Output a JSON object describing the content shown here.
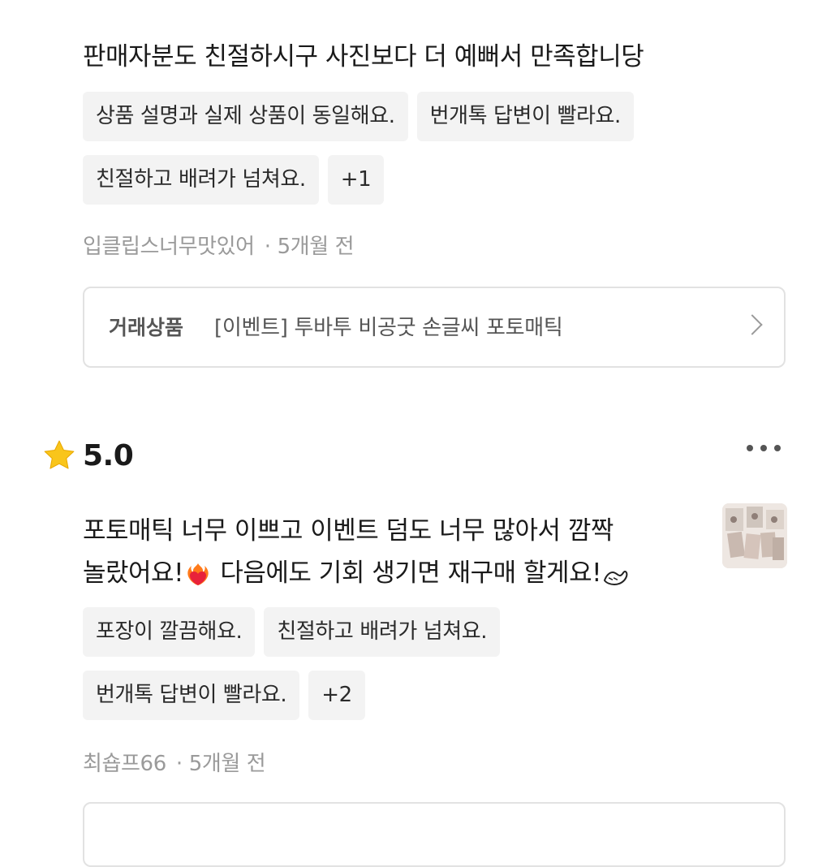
{
  "review1": {
    "text": "판매자분도 친절하시구 사진보다 더 예뻐서 만족합니당",
    "tags_row1": [
      "상품 설명과 실제 상품이 동일해요.",
      "번개톡 답변이 빨라요."
    ],
    "tags_row2": [
      "친절하고 배려가 넘쳐요.",
      "+1"
    ],
    "author": "입클립스너무맛있어",
    "time": "5개월 전",
    "product_label": "거래상품",
    "product_name": "[이벤트] 투바투 비공굿 손글씨 포토매틱"
  },
  "review2": {
    "rating": "5.0",
    "text_line1": "포토매틱 너무 이쁘고 이벤트 덤도 너무 많아서 깜짝",
    "text_line2a": "놀랐어요!",
    "text_line2b": " 다음에도 기회 생기면 재구매 할게요!",
    "tags_row1": [
      "포장이 깔끔해요.",
      "친절하고 배려가 넘쳐요."
    ],
    "tags_row2": [
      "번개톡 답변이 빨라요.",
      "+2"
    ],
    "author": "최숍프66",
    "time": "5개월 전"
  },
  "icons": {
    "rating_star": "star-icon",
    "more": "more-options-icon",
    "chevron": "chevron-right-icon",
    "heart_on_fire": "heart-on-fire-emoji",
    "hand_heart": "finger-heart-emoji"
  },
  "colors": {
    "star": "#F9C51B",
    "tag_bg": "#F3F3F3",
    "meta_text": "#9A9A9A",
    "card_border": "#E2E2E2"
  }
}
